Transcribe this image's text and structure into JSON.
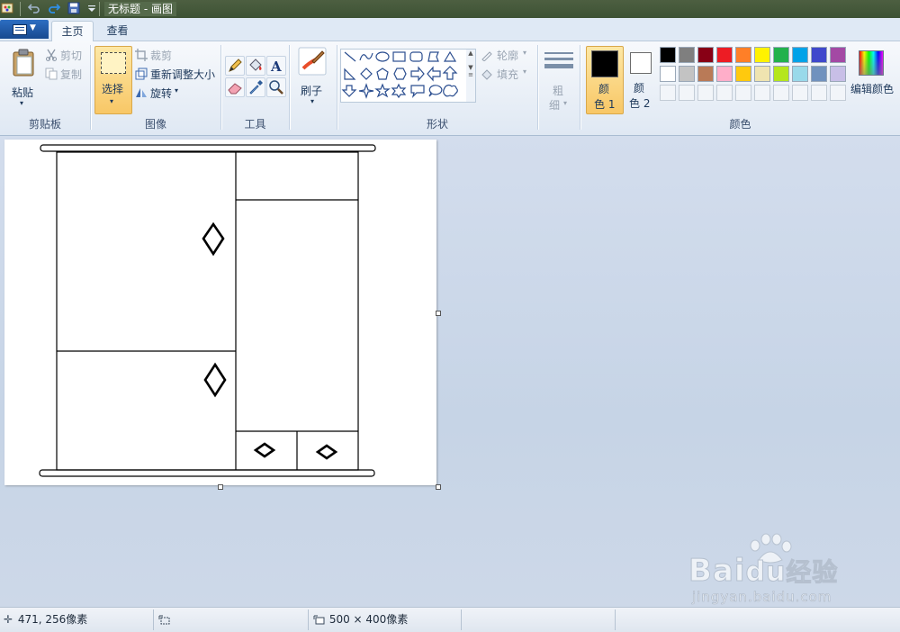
{
  "window": {
    "title": "无标题 - 画图"
  },
  "tabs": {
    "home": "主页",
    "view": "查看"
  },
  "clipboard": {
    "paste": "粘贴",
    "cut": "剪切",
    "copy": "复制",
    "label": "剪贴板"
  },
  "image": {
    "select": "选择",
    "crop": "裁剪",
    "resize": "重新调整大小",
    "rotate": "旋转",
    "label": "图像"
  },
  "tools": {
    "label": "工具"
  },
  "brushes": {
    "label": "刷子"
  },
  "shapes": {
    "outline": "轮廓",
    "fill": "填充",
    "label": "形状"
  },
  "size": {
    "label_a": "粗",
    "label_b": "细"
  },
  "colors": {
    "color1_a": "颜",
    "color1_b": "色 1",
    "color2_a": "颜",
    "color2_b": "色 2",
    "edit": "编辑颜色",
    "label": "颜色",
    "palette_row1": [
      "#000000",
      "#7f7f7f",
      "#880015",
      "#ed1c24",
      "#ff7f27",
      "#fff200",
      "#22b14c",
      "#00a2e8",
      "#3f48cc",
      "#a349a4"
    ],
    "palette_row2": [
      "#ffffff",
      "#c3c3c3",
      "#b97a57",
      "#ffaec9",
      "#ffc90e",
      "#efe4b0",
      "#b5e61d",
      "#99d9ea",
      "#7092be",
      "#c8bfe7"
    ],
    "active_color1": "#000000",
    "active_color2": "#ffffff"
  },
  "status": {
    "cursor_pos": "471, 256像素",
    "canvas_size": "500 × 400像素"
  },
  "watermark": {
    "brand": "Bai",
    "brand_du": "du",
    "brand_cn": "经验",
    "url": "jingyan.baidu.com"
  }
}
